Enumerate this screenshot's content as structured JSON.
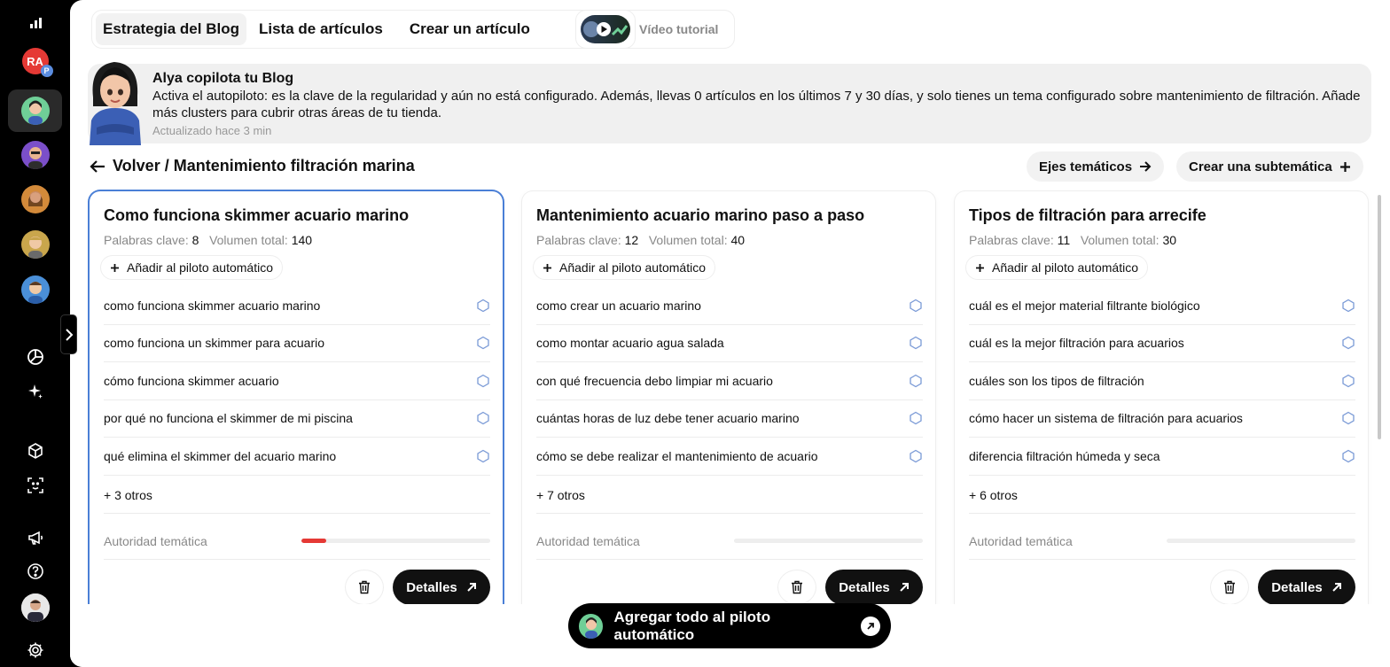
{
  "sidebar": {
    "workspace_initials": "RA",
    "workspace_badge": "P"
  },
  "tabs": [
    {
      "label": "Estrategia del Blog",
      "active": true
    },
    {
      "label": "Lista de artículos",
      "active": false
    },
    {
      "label": "Crear un artículo",
      "active": false
    }
  ],
  "video": {
    "label": "Vídeo tutorial"
  },
  "banner": {
    "title": "Alya copilota tu Blog",
    "text": "Activa el autopiloto: es la clave de la regularidad y aún no está configurado. Además, llevas 0 artículos en los últimos 7 y 30 días, y solo tienes un tema configurado sobre mantenimiento de filtración. Añade más clusters para cubrir otras áreas de tu tienda.",
    "updated": "Actualizado hace 3 min"
  },
  "breadcrumb": {
    "label": "Volver / Mantenimiento filtración marina"
  },
  "actions": {
    "ejes_label": "Ejes temáticos",
    "crear_label": "Crear una subtemática"
  },
  "labels": {
    "keywords": "Palabras clave:",
    "volume": "Volumen total:",
    "autopilot": "Añadir al piloto automático",
    "authority": "Autoridad temática",
    "details": "Detalles"
  },
  "cards": [
    {
      "title": "Como funciona skimmer acuario marino",
      "keywords_count": "8",
      "volume": "140",
      "keywords": [
        "como funciona skimmer acuario marino",
        "como funciona un skimmer para acuario",
        "cómo funciona skimmer acuario",
        "por qué no funciona el skimmer de mi piscina",
        "qué elimina el skimmer del acuario marino"
      ],
      "more": "+ 3 otros",
      "authority": 0.13,
      "selected": true
    },
    {
      "title": "Mantenimiento acuario marino paso a paso",
      "keywords_count": "12",
      "volume": "40",
      "keywords": [
        "como crear un acuario marino",
        "como montar acuario agua salada",
        "con qué frecuencia debo limpiar mi acuario",
        "cuántas horas de luz debe tener acuario marino",
        "cómo se debe realizar el mantenimiento de acuario"
      ],
      "more": "+ 7 otros",
      "authority": 0,
      "selected": false
    },
    {
      "title": "Tipos de filtración para arrecife",
      "keywords_count": "11",
      "volume": "30",
      "keywords": [
        "cuál es el mejor material filtrante biológico",
        "cuál es la mejor filtración para acuarios",
        "cuáles son los tipos de filtración",
        "cómo hacer un sistema de filtración para acuarios",
        "diferencia filtración húmeda y seca"
      ],
      "more": "+ 6 otros",
      "authority": 0,
      "selected": false
    }
  ],
  "cta": {
    "label": "Agregar todo al piloto automático"
  },
  "colors": {
    "accent_blue": "#4a7fd6",
    "authority_red": "#e53935"
  }
}
